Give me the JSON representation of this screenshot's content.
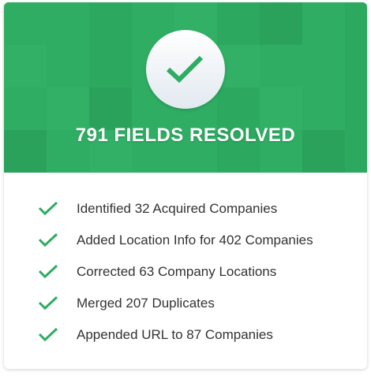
{
  "header": {
    "title": "791 FIELDS RESOLVED",
    "icon": "checkmark-icon",
    "color": "#2fac62"
  },
  "items": [
    {
      "label": "Identified 32 Acquired Companies",
      "icon": "checkmark-icon"
    },
    {
      "label": "Added Location Info for 402 Companies",
      "icon": "checkmark-icon"
    },
    {
      "label": "Corrected 63 Company Locations",
      "icon": "checkmark-icon"
    },
    {
      "label": "Merged 207 Duplicates",
      "icon": "checkmark-icon"
    },
    {
      "label": "Appended URL to 87 Companies",
      "icon": "checkmark-icon"
    }
  ]
}
